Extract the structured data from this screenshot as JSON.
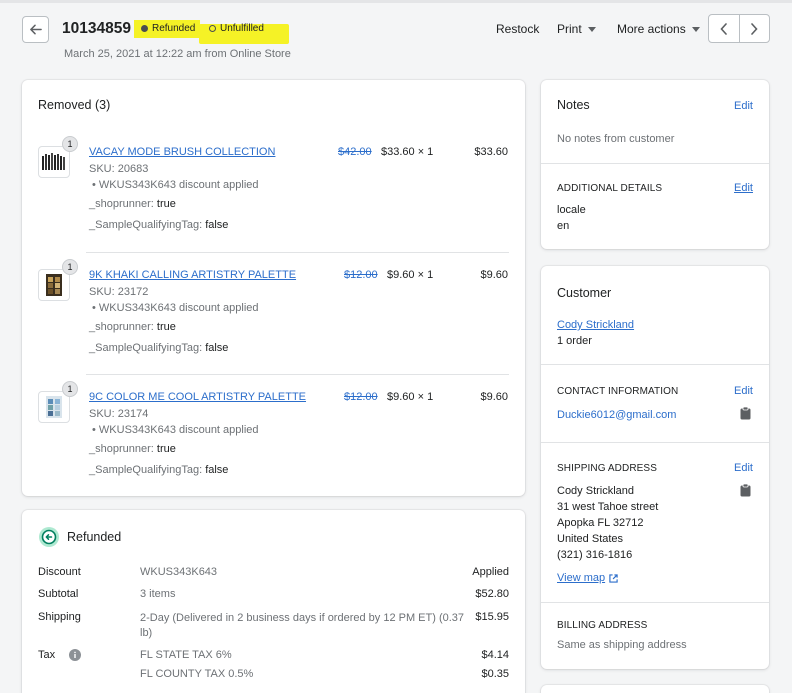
{
  "header": {
    "order_number": "10134859",
    "badges": [
      {
        "label": "Refunded",
        "dot_color": "#5c5f62"
      },
      {
        "label": "Unfulfilled",
        "dot_color": "hollow"
      }
    ],
    "subtitle": "March 25, 2021 at 12:22 am from Online Store",
    "actions": {
      "restock": "Restock",
      "print": "Print",
      "more": "More actions"
    },
    "highlight_color": "#f5f226"
  },
  "removed": {
    "title": "Removed (3)",
    "items": [
      {
        "name": "VACAY MODE BRUSH COLLECTION",
        "sku": "SKU: 20683",
        "qty_badge": "1",
        "discount": "WKUS343K643 discount applied",
        "prop1_key": "_shoprunner:",
        "prop1_val": "true",
        "prop2_key": "_SampleQualifyingTag:",
        "prop2_val": "false",
        "original_price": "$42.00",
        "unit_price": "$33.60 × 1",
        "total": "$33.60",
        "thumb_icon": "brush-set-icon"
      },
      {
        "name": "9K KHAKI CALLING ARTISTRY PALETTE",
        "sku": "SKU: 23172",
        "qty_badge": "1",
        "discount": "WKUS343K643 discount applied",
        "prop1_key": "_shoprunner:",
        "prop1_val": "true",
        "prop2_key": "_SampleQualifyingTag:",
        "prop2_val": "false",
        "original_price": "$12.00",
        "unit_price": "$9.60 × 1",
        "total": "$9.60",
        "thumb_icon": "khaki-palette-icon"
      },
      {
        "name": "9C COLOR ME COOL ARTISTRY PALETTE",
        "sku": "SKU: 23174",
        "qty_badge": "1",
        "discount": "WKUS343K643 discount applied",
        "prop1_key": "_shoprunner:",
        "prop1_val": "true",
        "prop2_key": "_SampleQualifyingTag:",
        "prop2_val": "false",
        "original_price": "$12.00",
        "unit_price": "$9.60 × 1",
        "total": "$9.60",
        "thumb_icon": "cool-palette-icon"
      }
    ]
  },
  "refunded": {
    "title": "Refunded",
    "rows": [
      {
        "label": "Discount",
        "mid": "WKUS343K643",
        "value": "Applied"
      },
      {
        "label": "Subtotal",
        "mid": "3 items",
        "value": "$52.80"
      },
      {
        "label": "Shipping",
        "mid": "2-Day (Delivered in 2 business days if ordered by 12 PM ET) (0.37 lb)",
        "value": "$15.95"
      },
      {
        "label": "Tax",
        "mid": "FL STATE TAX 6%",
        "value": "$4.14"
      },
      {
        "label": "",
        "mid": "FL COUNTY TAX 0.5%",
        "value": "$0.35"
      }
    ]
  },
  "notes": {
    "title": "Notes",
    "edit": "Edit",
    "empty": "No notes from customer",
    "additional_title": "ADDITIONAL DETAILS",
    "additional_edit": "Edit",
    "locale_key": "locale",
    "locale_val": "en"
  },
  "customer": {
    "title": "Customer",
    "name": "Cody Strickland",
    "orders": "1 order",
    "contact_title": "CONTACT INFORMATION",
    "contact_edit": "Edit",
    "email": "Duckie6012@gmail.com",
    "shipping_title": "SHIPPING ADDRESS",
    "shipping_edit": "Edit",
    "address": [
      "Cody Strickland",
      "31 west Tahoe street",
      "Apopka FL 32712",
      "United States",
      "(321) 316-1816"
    ],
    "view_map": "View map",
    "billing_title": "BILLING ADDRESS",
    "billing_text": "Same as shipping address"
  }
}
